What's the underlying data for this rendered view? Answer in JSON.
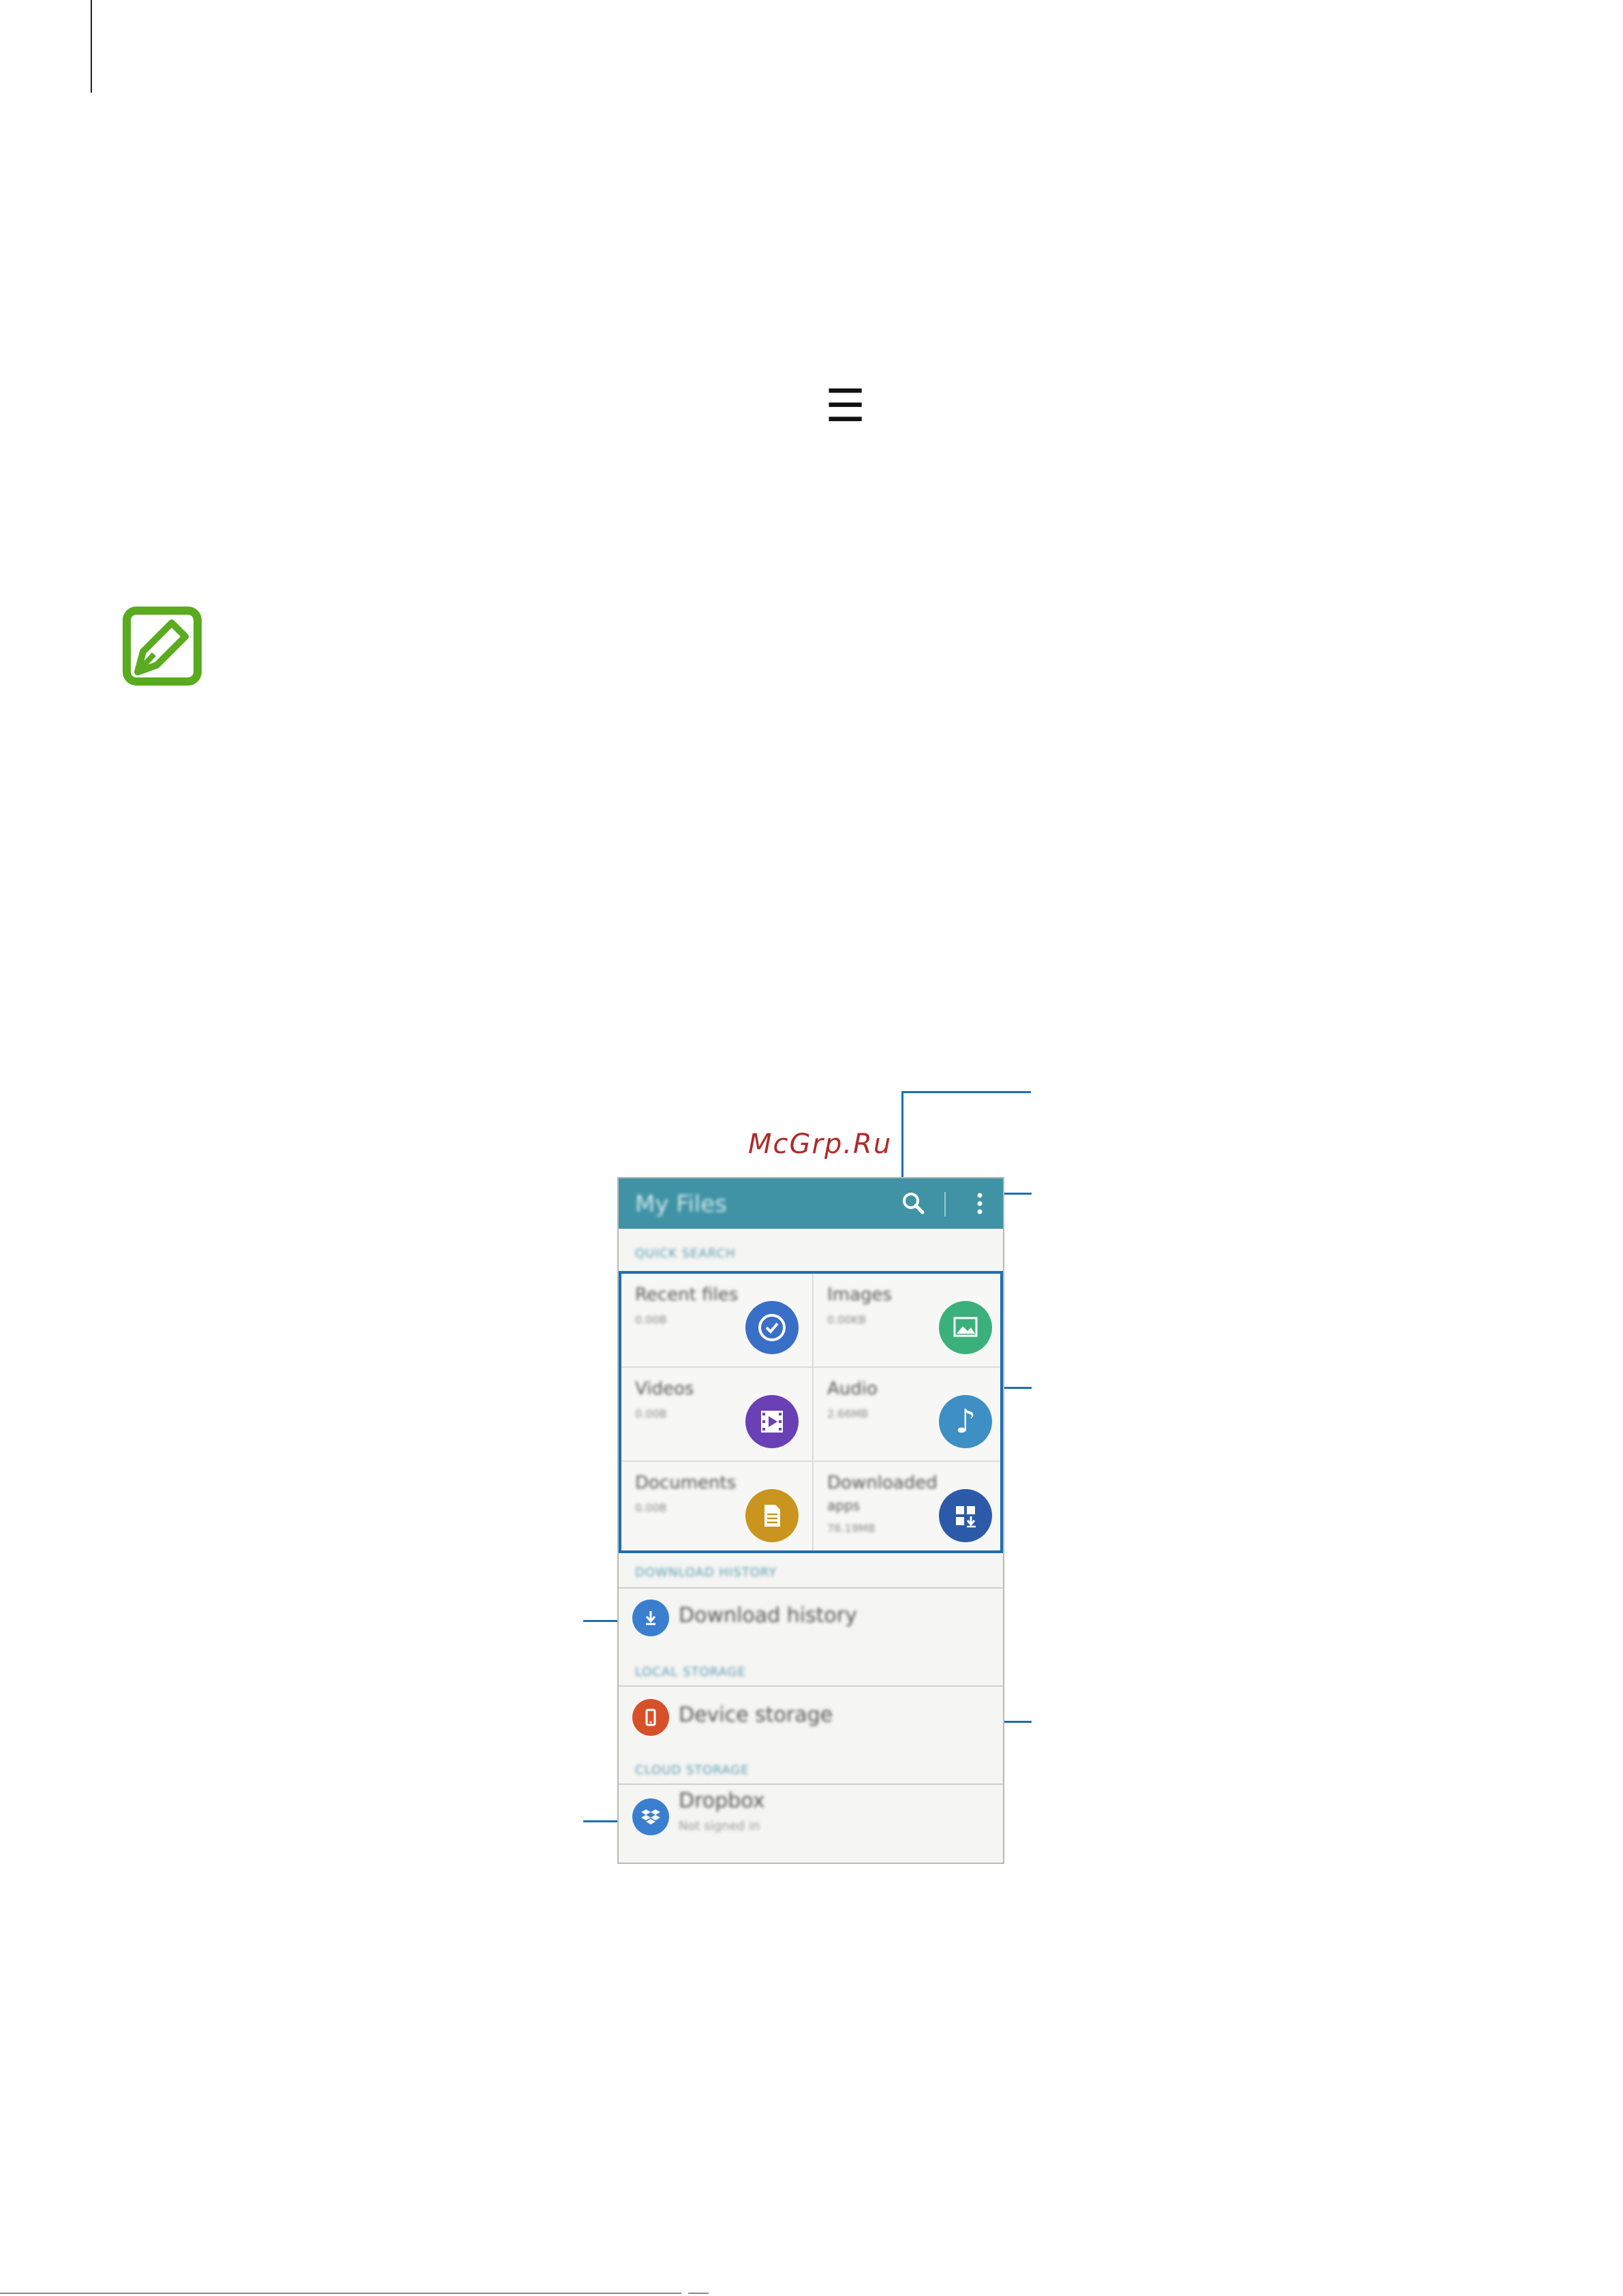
{
  "page": {
    "menu_glyph": "☰",
    "watermark": "McGrp.Ru",
    "watermark_color": "#b02a2a",
    "note_icon": "note-pencil-icon",
    "note_icon_color": "#5aab1f"
  },
  "screen": {
    "app_title": "My Files",
    "appbar_color": "#3f93a5",
    "search_icon": "search-icon",
    "more_icon": "more-options-icon",
    "sections": {
      "quick_search": "QUICK SEARCH",
      "download_history": "DOWNLOAD HISTORY",
      "local_storage": "LOCAL STORAGE",
      "cloud_storage": "CLOUD STORAGE"
    },
    "categories": [
      {
        "title": "Recent files",
        "size": "0.00B",
        "icon": "clock-icon",
        "color": "#3a6fc7"
      },
      {
        "title": "Images",
        "size": "0.00KB",
        "icon": "image-icon",
        "color": "#3bb07a"
      },
      {
        "title": "Videos",
        "size": "0.00B",
        "icon": "video-icon",
        "color": "#6a40b6"
      },
      {
        "title": "Audio",
        "size": "2.66MB",
        "icon": "music-note-icon",
        "color": "#3d8fc4"
      },
      {
        "title": "Documents",
        "size": "0.00B",
        "icon": "document-icon",
        "color": "#c9951f"
      },
      {
        "title": "Downloaded",
        "title2": "apps",
        "size": "76.19MB",
        "icon": "apps-download-icon",
        "color": "#2c5aa8"
      }
    ],
    "download_history": {
      "label": "Download history",
      "icon": "download-icon",
      "color": "#3a7ed0"
    },
    "device_storage": {
      "label": "Device storage",
      "icon": "phone-icon",
      "color": "#d6512a"
    },
    "dropbox": {
      "label": "Dropbox",
      "sub": "Not signed in",
      "icon": "dropbox-icon",
      "color": "#3a7ed0"
    }
  }
}
